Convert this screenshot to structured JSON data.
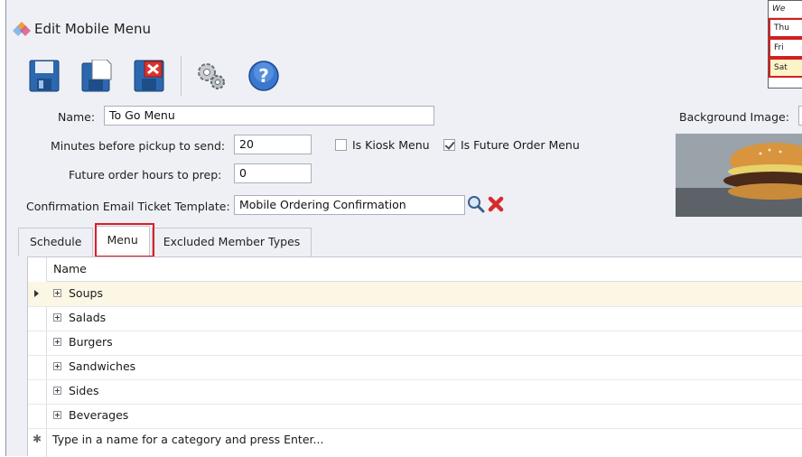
{
  "window": {
    "title": "Edit Mobile Menu"
  },
  "toolbar": {
    "save": "save-icon",
    "save_close": "save-close-icon",
    "discard": "discard-icon",
    "settings": "gears-icon",
    "help": "help-icon"
  },
  "form": {
    "name_label": "Name:",
    "name_value": "To Go Menu",
    "minutes_label": "Minutes before pickup to send:",
    "minutes_value": "20",
    "kiosk_label": "Is Kiosk Menu",
    "kiosk_checked": false,
    "future_label": "Is Future Order Menu",
    "future_checked": true,
    "hours_label": "Future order hours to prep:",
    "hours_value": "0",
    "template_label": "Confirmation Email Ticket Template:",
    "template_value": "Mobile Ordering Confirmation",
    "bg_label": "Background Image:"
  },
  "popup": {
    "rows": [
      "We",
      "Thu",
      "Fri",
      "Sat"
    ]
  },
  "tabs": [
    {
      "label": "Schedule"
    },
    {
      "label": "Menu"
    },
    {
      "label": "Excluded Member Types"
    }
  ],
  "grid": {
    "column": "Name",
    "rows": [
      {
        "name": "Soups"
      },
      {
        "name": "Salads"
      },
      {
        "name": "Burgers"
      },
      {
        "name": "Sandwiches"
      },
      {
        "name": "Sides"
      },
      {
        "name": "Beverages"
      }
    ],
    "new_row_placeholder": "Type in a name for a category and press Enter..."
  },
  "colors": {
    "highlight": "#e01c24",
    "selected_row": "#fcf6e5",
    "panel": "#eef0f5"
  }
}
